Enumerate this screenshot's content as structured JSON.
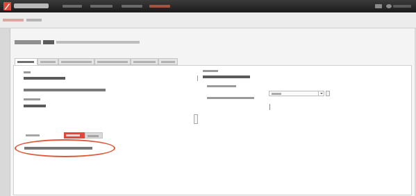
{
  "app": {
    "brand": "",
    "nav_items": [
      "",
      "",
      "",
      ""
    ],
    "user": ""
  },
  "breadcrumb": {
    "link": "",
    "current": ""
  },
  "page": {
    "title_primary": "",
    "title_secondary": "",
    "title_desc": ""
  },
  "tabs": [
    {
      "label": "",
      "active": true
    },
    {
      "label": "",
      "active": false
    },
    {
      "label": "",
      "active": false
    },
    {
      "label": "",
      "active": false
    },
    {
      "label": "",
      "active": false
    },
    {
      "label": "",
      "active": false
    }
  ],
  "left_column": {
    "name_label": "",
    "name_value": "",
    "link_text": "",
    "desc_label": "",
    "desc_value": ""
  },
  "right_column": {
    "section_label": "",
    "section_value": "",
    "row1_label": "",
    "row1_select": "",
    "row2_label": ""
  },
  "subtabs": [
    {
      "label": "",
      "active": false
    },
    {
      "label": "",
      "active": true
    },
    {
      "label": "",
      "active": false
    }
  ],
  "highlighted_item": "",
  "colors": {
    "accent": "#e2473a",
    "topbar": "#222222",
    "highlight_ring": "#e05a3a"
  }
}
